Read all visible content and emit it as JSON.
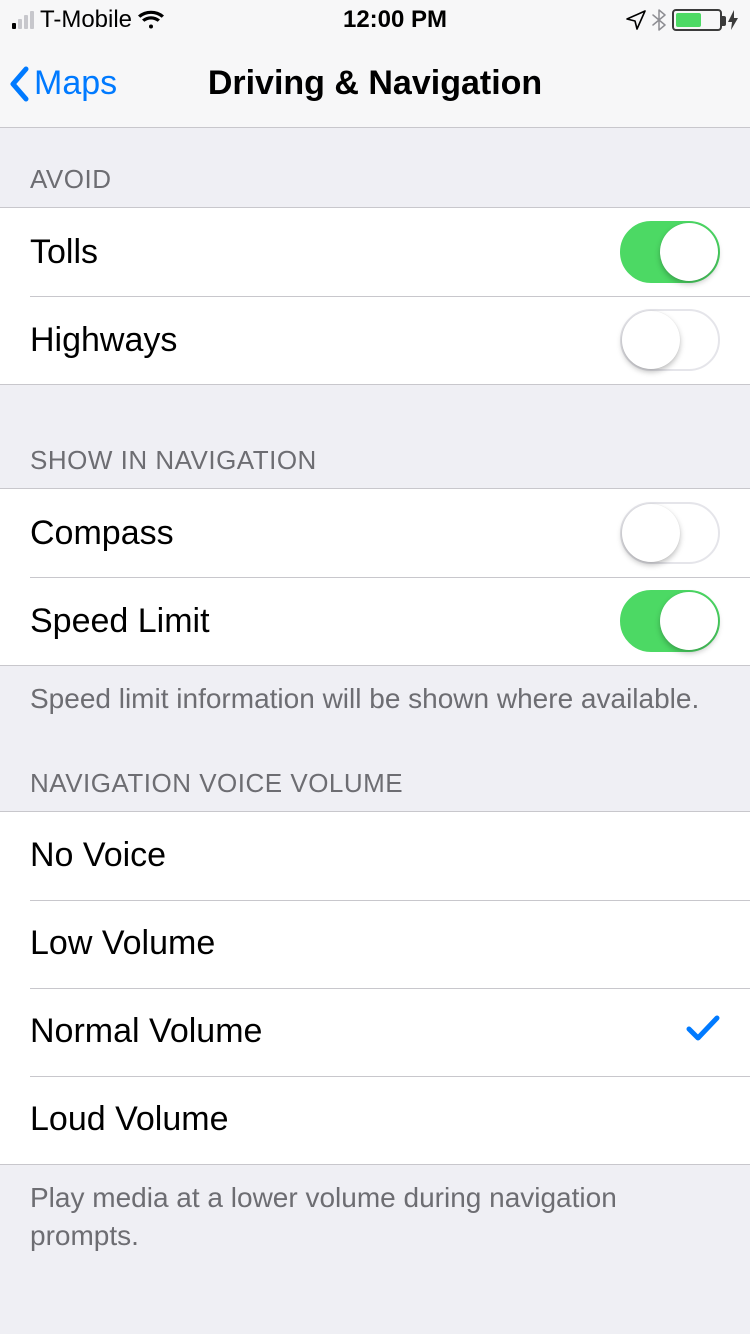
{
  "status": {
    "carrier": "T-Mobile",
    "time": "12:00 PM"
  },
  "nav": {
    "back_label": "Maps",
    "title": "Driving & Navigation"
  },
  "sections": {
    "avoid": {
      "header": "AVOID",
      "tolls": {
        "label": "Tolls",
        "on": true
      },
      "highways": {
        "label": "Highways",
        "on": false
      }
    },
    "show": {
      "header": "SHOW IN NAVIGATION",
      "compass": {
        "label": "Compass",
        "on": false
      },
      "speed_limit": {
        "label": "Speed Limit",
        "on": true
      },
      "footer": "Speed limit information will be shown where available."
    },
    "volume": {
      "header": "NAVIGATION VOICE VOLUME",
      "options": [
        {
          "label": "No Voice",
          "selected": false
        },
        {
          "label": "Low Volume",
          "selected": false
        },
        {
          "label": "Normal Volume",
          "selected": true
        },
        {
          "label": "Loud Volume",
          "selected": false
        }
      ],
      "footer": "Play media at a lower volume during navigation prompts."
    }
  }
}
